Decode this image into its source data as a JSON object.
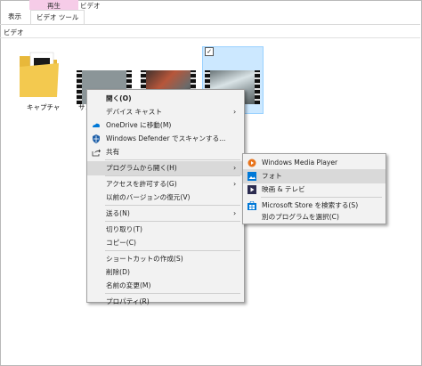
{
  "ribbon": {
    "context_group": "再生",
    "context_group_right": "ビデオ",
    "tabs": [
      "表示",
      "ビデオ ツール"
    ]
  },
  "address": "ビデオ",
  "files": [
    {
      "label": "キャプチャ",
      "type": "folder"
    },
    {
      "label": "サン",
      "type": "video"
    },
    {
      "label": "",
      "type": "video"
    },
    {
      "label": "",
      "type": "video",
      "selected": true
    }
  ],
  "context_menu": {
    "items": [
      {
        "label": "開く(O)",
        "bold": true
      },
      {
        "label": "デバイス キャスト",
        "submenu": true
      },
      {
        "label": "OneDrive に移動(M)",
        "icon": "onedrive-icon"
      },
      {
        "label": "Windows Defender でスキャンする...",
        "icon": "defender-shield-icon"
      },
      {
        "label": "共有",
        "icon": "share-icon"
      },
      {
        "label": "プログラムから開く(H)",
        "submenu": true,
        "highlighted": true
      },
      {
        "label": "アクセスを許可する(G)",
        "submenu": true
      },
      {
        "label": "以前のバージョンの復元(V)"
      },
      {
        "label": "送る(N)",
        "submenu": true
      },
      {
        "label": "切り取り(T)"
      },
      {
        "label": "コピー(C)"
      },
      {
        "label": "ショートカットの作成(S)"
      },
      {
        "label": "削除(D)"
      },
      {
        "label": "名前の変更(M)"
      },
      {
        "label": "プロパティ(R)"
      }
    ]
  },
  "open_with_menu": {
    "items": [
      {
        "label": "Windows Media Player",
        "icon": "media-player-icon"
      },
      {
        "label": "フォト",
        "icon": "photos-icon",
        "highlighted": true
      },
      {
        "label": "映画 & テレビ",
        "icon": "movies-tv-icon"
      },
      {
        "label": "Microsoft Store を検索する(S)",
        "icon": "store-icon"
      },
      {
        "label": "別のプログラムを選択(C)"
      }
    ]
  },
  "colors": {
    "accent": "#0078d7",
    "selection": "#cce8ff",
    "menu_bg": "#f2f2f2",
    "highlight": "#d9d9d9",
    "context_tab": "#f6cce8"
  }
}
